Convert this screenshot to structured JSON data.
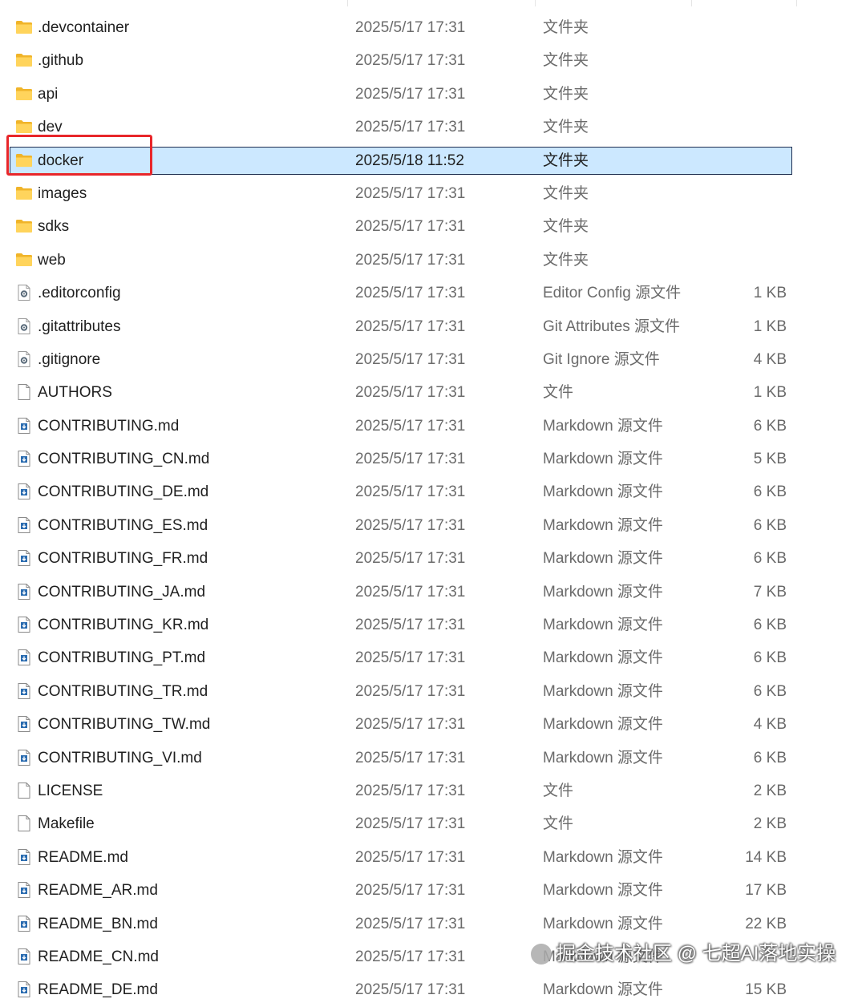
{
  "files": [
    {
      "name": ".devcontainer",
      "date": "2025/5/17 17:31",
      "type": "文件夹",
      "size": "",
      "icon": "folder-icon"
    },
    {
      "name": ".github",
      "date": "2025/5/17 17:31",
      "type": "文件夹",
      "size": "",
      "icon": "folder-icon"
    },
    {
      "name": "api",
      "date": "2025/5/17 17:31",
      "type": "文件夹",
      "size": "",
      "icon": "folder-icon"
    },
    {
      "name": "dev",
      "date": "2025/5/17 17:31",
      "type": "文件夹",
      "size": "",
      "icon": "folder-icon"
    },
    {
      "name": "docker",
      "date": "2025/5/18 11:52",
      "type": "文件夹",
      "size": "",
      "icon": "folder-icon",
      "selected": true
    },
    {
      "name": "images",
      "date": "2025/5/17 17:31",
      "type": "文件夹",
      "size": "",
      "icon": "folder-icon"
    },
    {
      "name": "sdks",
      "date": "2025/5/17 17:31",
      "type": "文件夹",
      "size": "",
      "icon": "folder-icon"
    },
    {
      "name": "web",
      "date": "2025/5/17 17:31",
      "type": "文件夹",
      "size": "",
      "icon": "folder-icon"
    },
    {
      "name": ".editorconfig",
      "date": "2025/5/17 17:31",
      "type": "Editor Config 源文件",
      "size": "1 KB",
      "icon": "config-file-icon"
    },
    {
      "name": ".gitattributes",
      "date": "2025/5/17 17:31",
      "type": "Git Attributes 源文件",
      "size": "1 KB",
      "icon": "config-file-icon"
    },
    {
      "name": ".gitignore",
      "date": "2025/5/17 17:31",
      "type": "Git Ignore 源文件",
      "size": "4 KB",
      "icon": "config-file-icon"
    },
    {
      "name": "AUTHORS",
      "date": "2025/5/17 17:31",
      "type": "文件",
      "size": "1 KB",
      "icon": "blank-file-icon"
    },
    {
      "name": "CONTRIBUTING.md",
      "date": "2025/5/17 17:31",
      "type": "Markdown 源文件",
      "size": "6 KB",
      "icon": "markdown-file-icon"
    },
    {
      "name": "CONTRIBUTING_CN.md",
      "date": "2025/5/17 17:31",
      "type": "Markdown 源文件",
      "size": "5 KB",
      "icon": "markdown-file-icon"
    },
    {
      "name": "CONTRIBUTING_DE.md",
      "date": "2025/5/17 17:31",
      "type": "Markdown 源文件",
      "size": "6 KB",
      "icon": "markdown-file-icon"
    },
    {
      "name": "CONTRIBUTING_ES.md",
      "date": "2025/5/17 17:31",
      "type": "Markdown 源文件",
      "size": "6 KB",
      "icon": "markdown-file-icon"
    },
    {
      "name": "CONTRIBUTING_FR.md",
      "date": "2025/5/17 17:31",
      "type": "Markdown 源文件",
      "size": "6 KB",
      "icon": "markdown-file-icon"
    },
    {
      "name": "CONTRIBUTING_JA.md",
      "date": "2025/5/17 17:31",
      "type": "Markdown 源文件",
      "size": "7 KB",
      "icon": "markdown-file-icon"
    },
    {
      "name": "CONTRIBUTING_KR.md",
      "date": "2025/5/17 17:31",
      "type": "Markdown 源文件",
      "size": "6 KB",
      "icon": "markdown-file-icon"
    },
    {
      "name": "CONTRIBUTING_PT.md",
      "date": "2025/5/17 17:31",
      "type": "Markdown 源文件",
      "size": "6 KB",
      "icon": "markdown-file-icon"
    },
    {
      "name": "CONTRIBUTING_TR.md",
      "date": "2025/5/17 17:31",
      "type": "Markdown 源文件",
      "size": "6 KB",
      "icon": "markdown-file-icon"
    },
    {
      "name": "CONTRIBUTING_TW.md",
      "date": "2025/5/17 17:31",
      "type": "Markdown 源文件",
      "size": "4 KB",
      "icon": "markdown-file-icon"
    },
    {
      "name": "CONTRIBUTING_VI.md",
      "date": "2025/5/17 17:31",
      "type": "Markdown 源文件",
      "size": "6 KB",
      "icon": "markdown-file-icon"
    },
    {
      "name": "LICENSE",
      "date": "2025/5/17 17:31",
      "type": "文件",
      "size": "2 KB",
      "icon": "blank-file-icon"
    },
    {
      "name": "Makefile",
      "date": "2025/5/17 17:31",
      "type": "文件",
      "size": "2 KB",
      "icon": "blank-file-icon"
    },
    {
      "name": "README.md",
      "date": "2025/5/17 17:31",
      "type": "Markdown 源文件",
      "size": "14 KB",
      "icon": "markdown-file-icon"
    },
    {
      "name": "README_AR.md",
      "date": "2025/5/17 17:31",
      "type": "Markdown 源文件",
      "size": "17 KB",
      "icon": "markdown-file-icon"
    },
    {
      "name": "README_BN.md",
      "date": "2025/5/17 17:31",
      "type": "Markdown 源文件",
      "size": "22 KB",
      "icon": "markdown-file-icon"
    },
    {
      "name": "README_CN.md",
      "date": "2025/5/17 17:31",
      "type": "Markdown 源文件",
      "size": "",
      "icon": "markdown-file-icon"
    },
    {
      "name": "README_DE.md",
      "date": "2025/5/17 17:31",
      "type": "Markdown 源文件",
      "size": "15 KB",
      "icon": "markdown-file-icon"
    }
  ],
  "watermark": {
    "text": "掘金技术社区 @ 七超AI落地实操"
  },
  "colors": {
    "selection": "#cce8ff",
    "highlight_box": "#e8262a",
    "folder": "#ffc83d"
  }
}
